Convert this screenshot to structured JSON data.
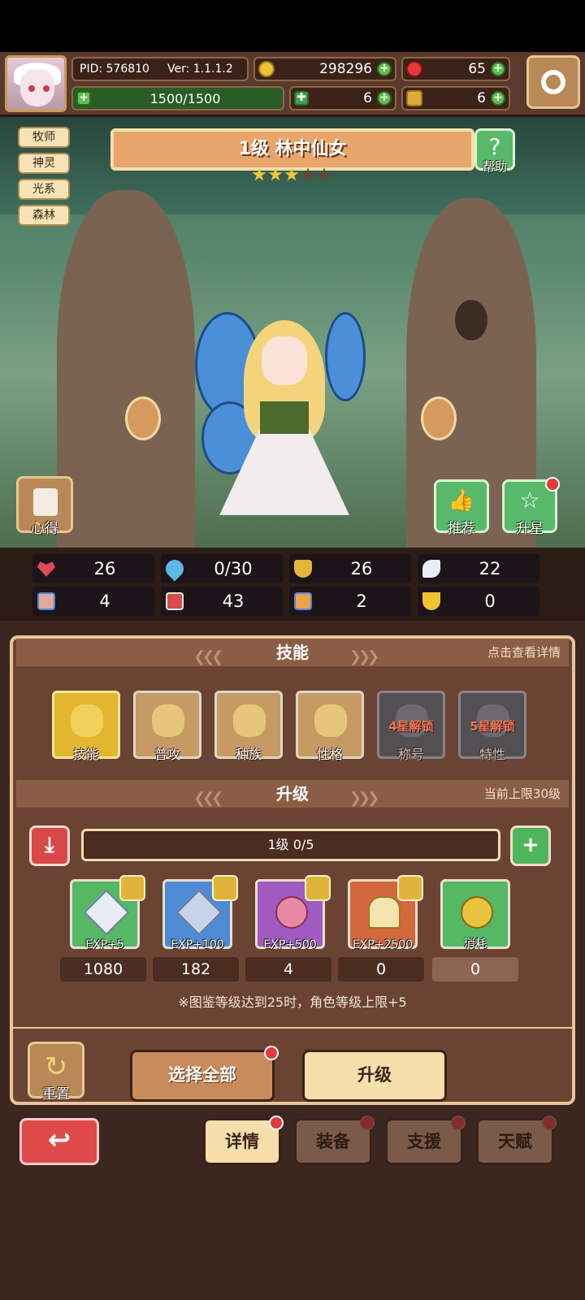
{
  "hud": {
    "pid": "PID: 576810",
    "version": "Ver: 1.1.1.2",
    "gold": "298296",
    "red_gems": "65",
    "energy": "1500/1500",
    "clover": "6",
    "ticket": "6"
  },
  "character": {
    "tags": [
      "牧师",
      "神灵",
      "光系",
      "森林"
    ],
    "title": "1级  林中仙女",
    "stars_filled": 3,
    "stars_total": 5,
    "help_label": "帮助",
    "insight_label": "心得",
    "recommend_label": "推荐",
    "star_up_label": "升星"
  },
  "stats": [
    {
      "icon": "heart-icon",
      "value": "26",
      "color": "#e0495b"
    },
    {
      "icon": "mana-drop-icon",
      "value": "0/30",
      "color": "#5db7e8"
    },
    {
      "icon": "shield-icon",
      "value": "26",
      "color": "#e6b43a"
    },
    {
      "icon": "wing-icon",
      "value": "22",
      "color": "#e9eef5"
    },
    {
      "icon": "fist-icon",
      "value": "4",
      "color": "#e2a7a0"
    },
    {
      "icon": "book-icon",
      "value": "43",
      "color": "#d94b4b"
    },
    {
      "icon": "boot-icon",
      "value": "2",
      "color": "#e8a548"
    },
    {
      "icon": "magnet-icon",
      "value": "0",
      "color": "#f2c22f"
    }
  ],
  "skills_section": {
    "title": "技能",
    "hint": "点击查看详情",
    "items": [
      {
        "label": "技能",
        "style": "gold"
      },
      {
        "label": "普攻",
        "style": "normal"
      },
      {
        "label": "种族",
        "style": "normal"
      },
      {
        "label": "性格",
        "style": "normal"
      },
      {
        "label": "称号",
        "style": "lock",
        "lock_text": "4星解锁"
      },
      {
        "label": "特性",
        "style": "lock",
        "lock_text": "5星解锁"
      }
    ]
  },
  "upgrade_section": {
    "title": "升级",
    "hint": "当前上限30级",
    "progress_text": "1级  0/5",
    "items": [
      {
        "label": "EXP+5",
        "qty": "1080",
        "color": "#55b865"
      },
      {
        "label": "EXP+100",
        "qty": "182",
        "color": "#4f8ad4"
      },
      {
        "label": "EXP+500",
        "qty": "4",
        "color": "#a05ac2"
      },
      {
        "label": "EXP+2500",
        "qty": "0",
        "color": "#d2683c"
      },
      {
        "label": "消耗",
        "qty": "0",
        "color": "#55b865"
      }
    ],
    "note": "※图鉴等级达到25时，角色等级上限+5",
    "reset_label": "重置",
    "select_all_label": "选择全部",
    "upgrade_label": "升级"
  },
  "bottom_tabs": {
    "details": "详情",
    "equipment": "装备",
    "support": "支援",
    "talent": "天赋"
  }
}
